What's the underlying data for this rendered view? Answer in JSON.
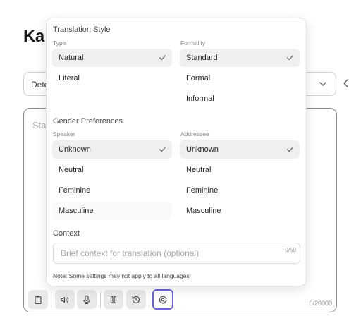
{
  "page": {
    "title_partial": "Ka"
  },
  "source_select": {
    "value_partial": "Dete"
  },
  "editor": {
    "placeholder_partial": "Star",
    "char_count": "0/20000"
  },
  "toolbar": {
    "items": [
      {
        "icon": "clipboard-icon"
      },
      {
        "icon": "speaker-icon"
      },
      {
        "icon": "microphone-icon"
      },
      {
        "icon": "pause-icon"
      },
      {
        "icon": "history-icon"
      },
      {
        "icon": "gear-icon",
        "active": true
      }
    ],
    "accent": "#6b63d9"
  },
  "popover": {
    "translation_style": {
      "title": "Translation Style",
      "type": {
        "label": "Type",
        "options": [
          "Natural",
          "Literal"
        ],
        "selected": "Natural"
      },
      "formality": {
        "label": "Formality",
        "options": [
          "Standard",
          "Formal",
          "Informal"
        ],
        "selected": "Standard"
      }
    },
    "gender": {
      "title": "Gender Preferences",
      "speaker": {
        "label": "Speaker",
        "options": [
          "Unknown",
          "Neutral",
          "Feminine",
          "Masculine"
        ],
        "selected": "Unknown"
      },
      "addressee": {
        "label": "Addressee",
        "options": [
          "Unknown",
          "Neutral",
          "Feminine",
          "Masculine"
        ],
        "selected": "Unknown"
      }
    },
    "context": {
      "label": "Context",
      "placeholder": "Brief context for translation (optional)",
      "value": "",
      "count": "0/50"
    },
    "note": "Note: Some settings may not apply to all languages"
  }
}
